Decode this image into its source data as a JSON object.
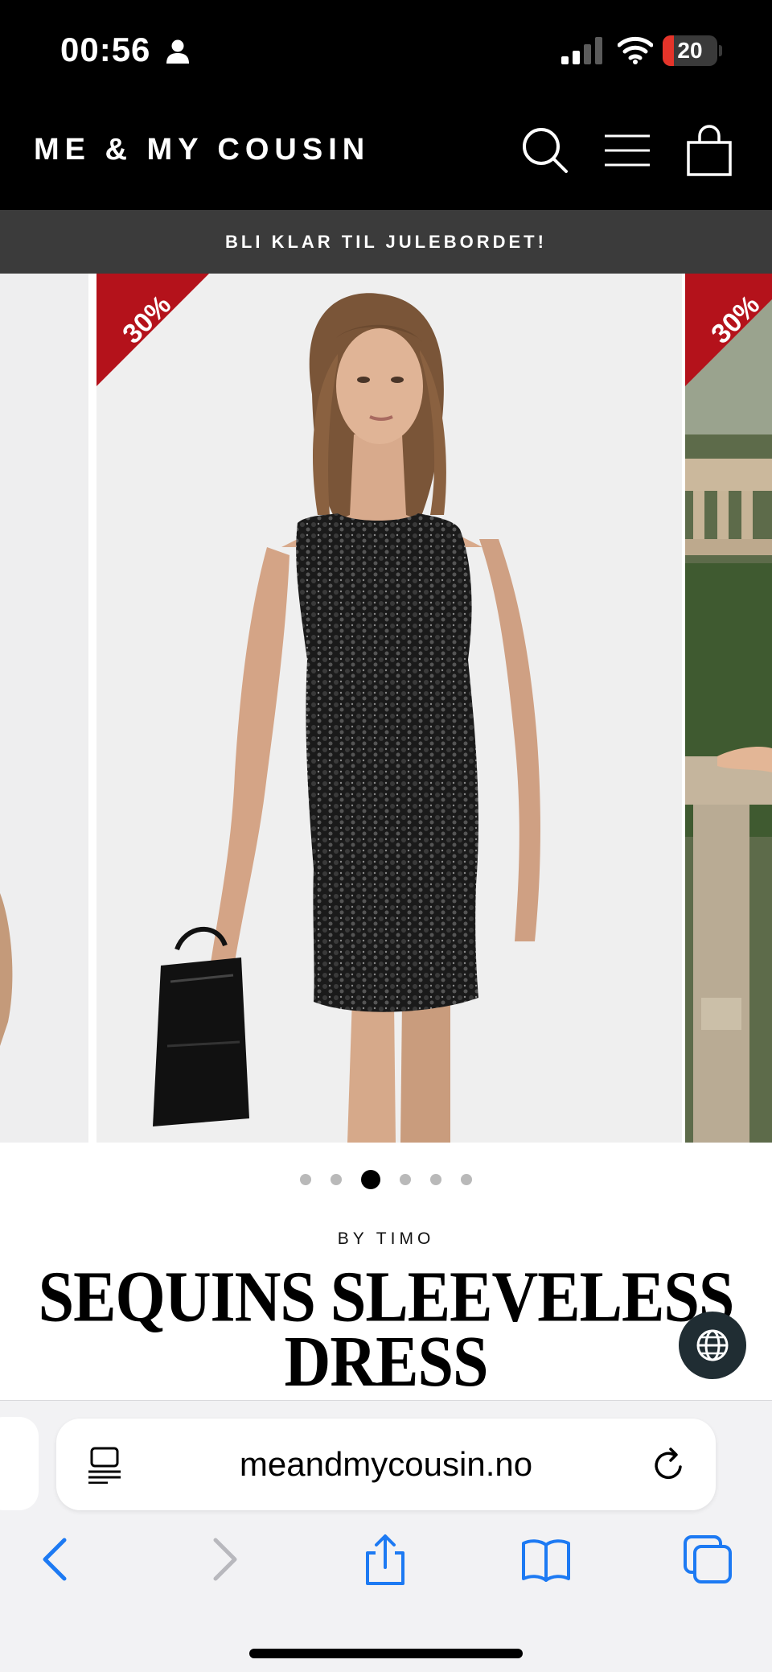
{
  "status_bar": {
    "time": "00:56",
    "battery_level": "20",
    "battery_percent": 20,
    "signal_bars_active": 2,
    "icons": [
      "person-icon",
      "cellular-signal-icon",
      "wifi-icon",
      "battery-icon"
    ]
  },
  "header": {
    "logo": "ME & MY COUSIN",
    "icons": [
      "search-icon",
      "hamburger-menu-icon",
      "shopping-bag-icon"
    ]
  },
  "announcement": {
    "text": "BLI KLAR TIL JULEBORDET!"
  },
  "gallery": {
    "badges": [
      {
        "label": "30%"
      },
      {
        "label": "30%"
      }
    ],
    "zoom_icon": "magnifier-icon",
    "slides_total": 6,
    "active_slide": 3
  },
  "product": {
    "vendor": "BY TIMO",
    "title_line1": "SEQUINS SLEEVELESS",
    "title_line2": "DRESS"
  },
  "safari": {
    "url": "meandmycousin.no",
    "icons": [
      "reader-mode-icon",
      "reload-icon",
      "back-icon",
      "forward-icon",
      "share-icon",
      "bookmarks-icon",
      "tabs-icon"
    ]
  },
  "colors": {
    "header_bg": "#000000",
    "announcement_bg": "#3b3b3b",
    "sale_badge": "#b4121b",
    "battery_low": "#e5342a",
    "safari_blue": "#1d7af3",
    "globe_button_bg": "#202d33"
  }
}
